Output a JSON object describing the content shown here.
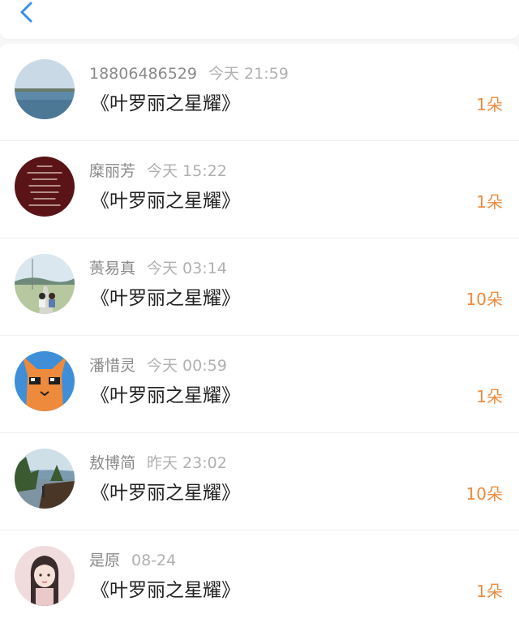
{
  "nav": {
    "back_icon": "chevron-left-icon",
    "accent": "#3a8ee6"
  },
  "records": [
    {
      "name": "18806486529",
      "time": "今天 21:59",
      "title": "《叶罗丽之星耀》",
      "count": "1朵"
    },
    {
      "name": "糜丽芳",
      "time": "今天 15:22",
      "title": "《叶罗丽之星耀》",
      "count": "1朵"
    },
    {
      "name": "蒉易真",
      "time": "今天 03:14",
      "title": "《叶罗丽之星耀》",
      "count": "10朵"
    },
    {
      "name": "潘惜灵",
      "time": "今天 00:59",
      "title": "《叶罗丽之星耀》",
      "count": "1朵"
    },
    {
      "name": "敖博简",
      "time": "昨天 23:02",
      "title": "《叶罗丽之星耀》",
      "count": "10朵"
    },
    {
      "name": "是原",
      "time": "08-24",
      "title": "《叶罗丽之星耀》",
      "count": "1朵"
    }
  ],
  "colors": {
    "count": "#ee8a3c",
    "name": "#8a8a8a",
    "time": "#b0b0b0",
    "title": "#222222"
  }
}
